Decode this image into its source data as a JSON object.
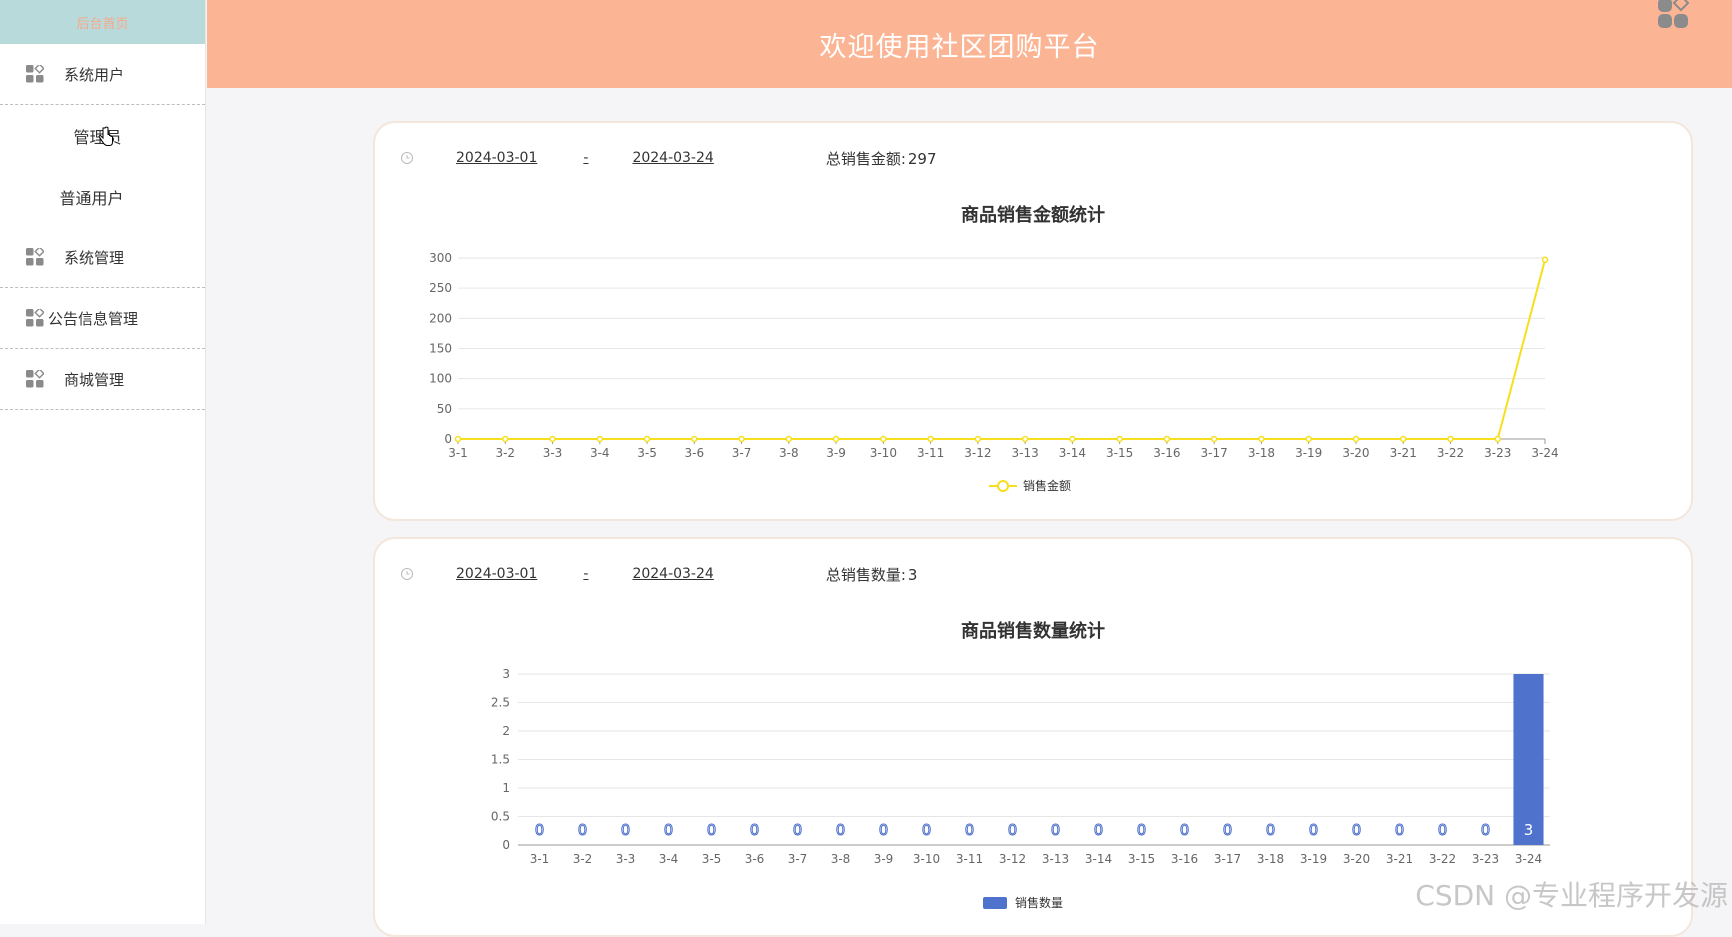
{
  "app": {
    "title": "欢迎使用社区团购平台",
    "home_link": "后台首页"
  },
  "sidebar": {
    "groups": [
      {
        "label": "系统用户",
        "children": [
          "管理员",
          "普通用户"
        ]
      },
      {
        "label": "系统管理",
        "children": []
      },
      {
        "label": "公告信息管理",
        "children": []
      },
      {
        "label": "商城管理",
        "children": []
      }
    ]
  },
  "colors": {
    "topbar": "#fbb595",
    "sidebar_home": "#b9dadb",
    "line_series": "#f7df1e",
    "bar_series": "#4f72cc"
  },
  "cards": [
    {
      "start_date": "2024-03-01",
      "separator": "-",
      "end_date": "2024-03-24",
      "total_label": "总销售金额:",
      "total_value": "297"
    },
    {
      "start_date": "2024-03-01",
      "separator": "-",
      "end_date": "2024-03-24",
      "total_label": "总销售数量:",
      "total_value": "3"
    }
  ],
  "chart_data": [
    {
      "type": "line",
      "title": "商品销售金额统计",
      "categories": [
        "3-1",
        "3-2",
        "3-3",
        "3-4",
        "3-5",
        "3-6",
        "3-7",
        "3-8",
        "3-9",
        "3-10",
        "3-11",
        "3-12",
        "3-13",
        "3-14",
        "3-15",
        "3-16",
        "3-17",
        "3-18",
        "3-19",
        "3-20",
        "3-21",
        "3-22",
        "3-23",
        "3-24"
      ],
      "series": [
        {
          "name": "销售金额",
          "values": [
            0,
            0,
            0,
            0,
            0,
            0,
            0,
            0,
            0,
            0,
            0,
            0,
            0,
            0,
            0,
            0,
            0,
            0,
            0,
            0,
            0,
            0,
            0,
            297
          ]
        }
      ],
      "ylim": [
        0,
        300
      ],
      "yticks": [
        0,
        50,
        100,
        150,
        200,
        250,
        300
      ],
      "grid": true,
      "legend": "bottom-center"
    },
    {
      "type": "bar",
      "title": "商品销售数量统计",
      "categories": [
        "3-1",
        "3-2",
        "3-3",
        "3-4",
        "3-5",
        "3-6",
        "3-7",
        "3-8",
        "3-9",
        "3-10",
        "3-11",
        "3-12",
        "3-13",
        "3-14",
        "3-15",
        "3-16",
        "3-17",
        "3-18",
        "3-19",
        "3-20",
        "3-21",
        "3-22",
        "3-23",
        "3-24"
      ],
      "series": [
        {
          "name": "销售数量",
          "values": [
            0,
            0,
            0,
            0,
            0,
            0,
            0,
            0,
            0,
            0,
            0,
            0,
            0,
            0,
            0,
            0,
            0,
            0,
            0,
            0,
            0,
            0,
            0,
            3
          ]
        }
      ],
      "ylim": [
        0,
        3
      ],
      "yticks": [
        0,
        0.5,
        1,
        1.5,
        2,
        2.5,
        3
      ],
      "grid": true,
      "legend": "bottom-center",
      "data_labels": true
    }
  ],
  "watermark": "CSDN @专业程序开发源"
}
